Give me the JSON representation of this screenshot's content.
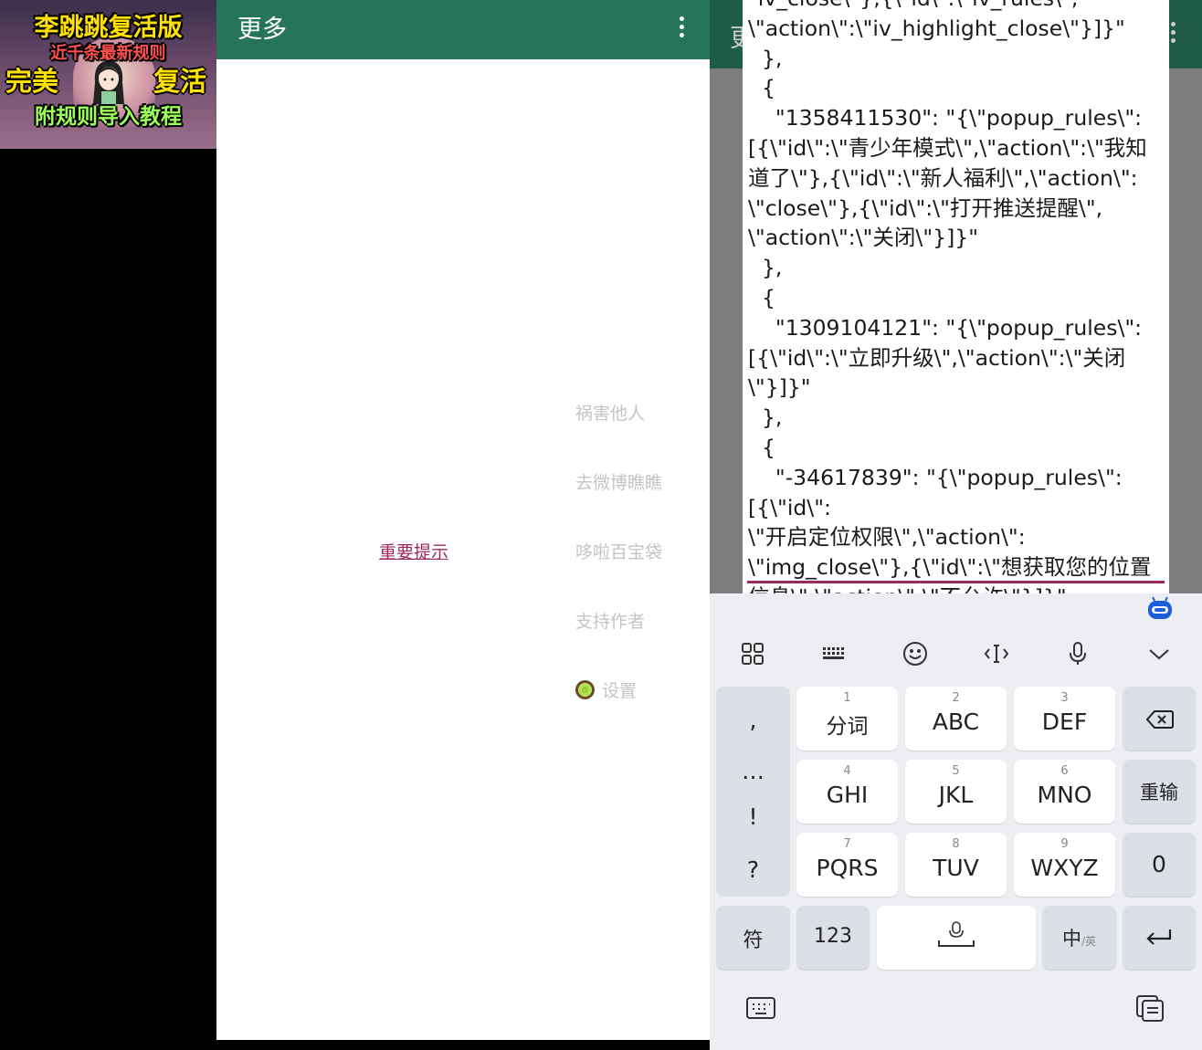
{
  "thumbnail": {
    "line1": "李跳跳复活版",
    "line2": "近千条最新规则",
    "line3_left": "完美",
    "line3_right": "复活",
    "line4": "附规则导入教程"
  },
  "left_app": {
    "title": "更多",
    "overflow_icon": "more-vert-icon",
    "notice_link": "重要提示",
    "menu": [
      "祸害他人",
      "去微博瞧瞧",
      "哆啦百宝袋",
      "支持作者",
      "设置"
    ],
    "settings_icon": "kiwi-icon",
    "colors": {
      "toolbar": "#26755a",
      "link": "#a0295c",
      "menu_text": "#c4c4c4"
    }
  },
  "right_app": {
    "title_partial": "更",
    "editor_text": "\"iv_close\\\"},{\\\"id\\\":\\\"iv_rules\\\",\n\\\"action\\\":\\\"iv_highlight_close\\\"}]}\"\n  },\n  {\n    \"1358411530\": \"{\\\"popup_rules\\\":\n[{\\\"id\\\":\\\"青少年模式\\\",\\\"action\\\":\\\"我知道了\\\"},{\\\"id\\\":\\\"新人福利\\\",\\\"action\\\":\n\\\"close\\\"},{\\\"id\\\":\\\"打开推送提醒\\\",\n\\\"action\\\":\\\"关闭\\\"}]}\"\n  },\n  {\n    \"1309104121\": \"{\\\"popup_rules\\\":\n[{\\\"id\\\":\\\"立即升级\\\",\\\"action\\\":\\\"关闭\\\"}]}\"\n  },\n  {\n    \"-34617839\": \"{\\\"popup_rules\\\":[{\\\"id\\\":\n\\\"开启定位权限\\\",\\\"action\\\":\n\\\"img_close\\\"},{\\\"id\\\":\\\"想获取您的位置信息\\\",\\\"action\\\":\\\"不允许\\\"}]}\"\n  },",
    "underline_color": "#a0295c"
  },
  "keyboard": {
    "toolbar_icons": [
      "apps-grid-icon",
      "keyboard-layout-icon",
      "emoji-icon",
      "cursor-icon",
      "microphone-icon",
      "collapse-icon"
    ],
    "side_symbols": [
      ",",
      "…",
      "!",
      "?"
    ],
    "keys": [
      {
        "num": "1",
        "label": "分词"
      },
      {
        "num": "2",
        "label": "ABC"
      },
      {
        "num": "3",
        "label": "DEF"
      },
      {
        "num": "4",
        "label": "GHI"
      },
      {
        "num": "5",
        "label": "JKL"
      },
      {
        "num": "6",
        "label": "MNO"
      },
      {
        "num": "7",
        "label": "PQRS"
      },
      {
        "num": "8",
        "label": "TUV"
      },
      {
        "num": "9",
        "label": "WXYZ"
      }
    ],
    "backspace_icon": "backspace-icon",
    "reenter": "重输",
    "zero": "0",
    "symbols": "符",
    "numbers": "123",
    "space_icon": "space-mic-icon",
    "lang_main": "中",
    "lang_sub": "/英",
    "enter_icon": "enter-icon",
    "bottom_left_icon": "keyboard-switch-icon",
    "bottom_right_icon": "clipboard-icon"
  }
}
